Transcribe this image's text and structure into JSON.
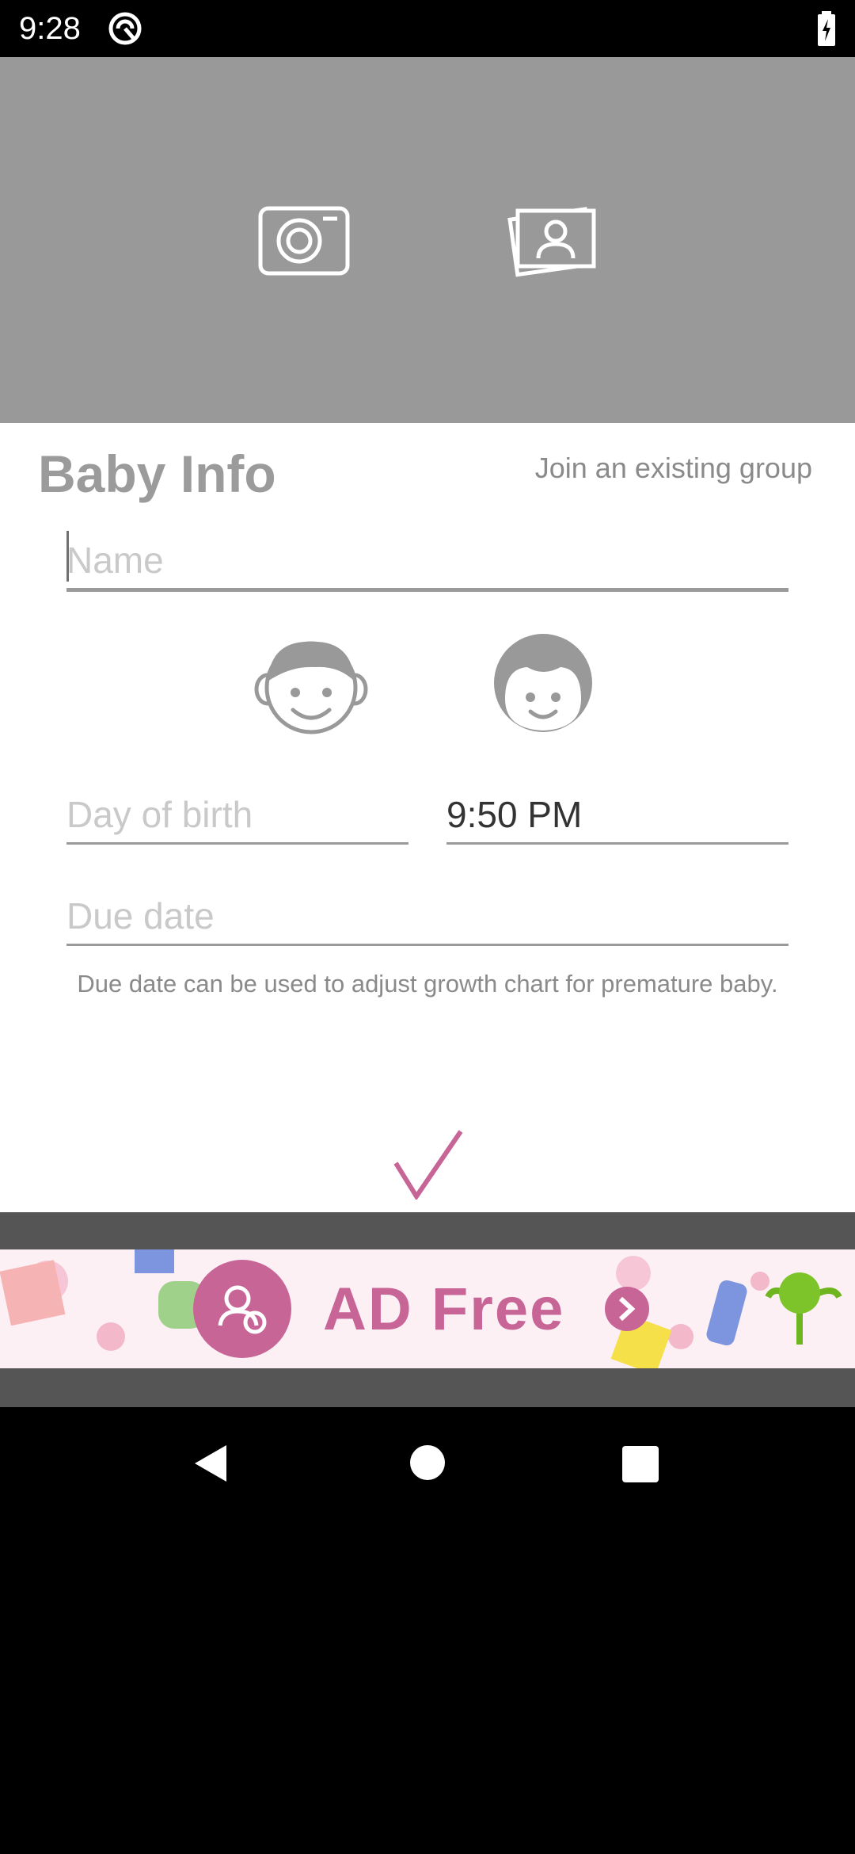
{
  "status_bar": {
    "time": "9:28"
  },
  "form": {
    "title": "Baby Info",
    "join_link": "Join an existing group",
    "name_placeholder": "Name",
    "dob_placeholder": "Day of birth",
    "time_value": "9:50 PM",
    "due_placeholder": "Due date",
    "due_hint": "Due date can be used to adjust growth chart for premature baby."
  },
  "ad": {
    "text": "AD Free"
  },
  "colors": {
    "header_bg": "#999999",
    "accent": "#c86597",
    "label_gray": "#9b9b9b"
  },
  "icons": [
    "camera-icon",
    "gallery-icon",
    "boy-icon",
    "girl-icon",
    "checkmark-icon",
    "back-icon",
    "home-icon",
    "recent-apps-icon"
  ]
}
